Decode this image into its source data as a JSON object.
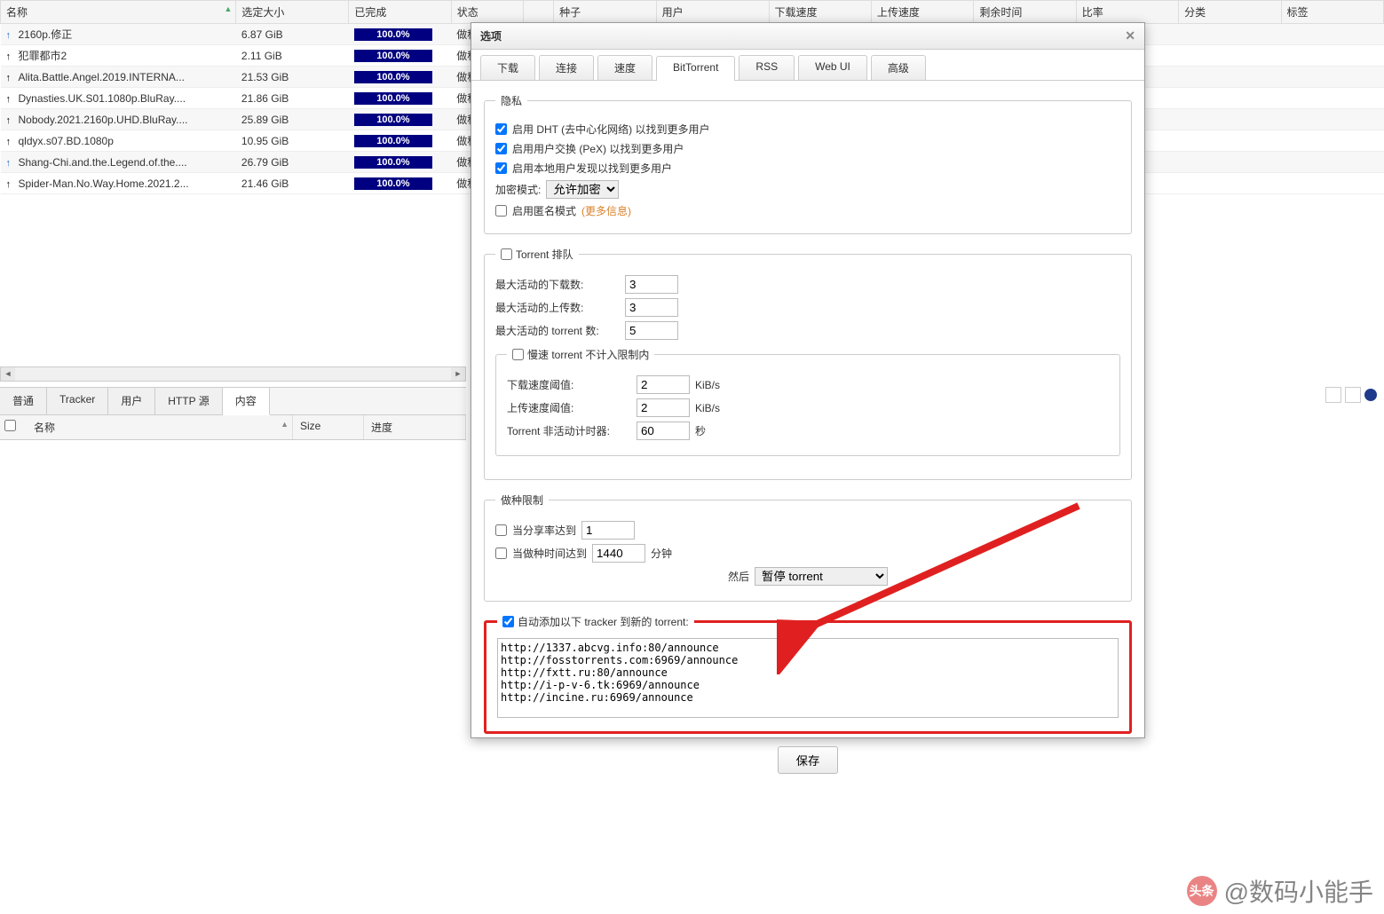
{
  "main": {
    "columns": [
      "名称",
      "选定大小",
      "已完成",
      "状态",
      "",
      "种子",
      "用户",
      "下载速度",
      "上传速度",
      "剩余时间",
      "比率",
      "分类",
      "标签"
    ],
    "sort_col": 0,
    "rows": [
      {
        "icon": "blue",
        "name": "2160p.修正",
        "size": "6.87 GiB",
        "done": "100.0%",
        "status": "做种"
      },
      {
        "icon": "black",
        "name": "犯罪都市2",
        "size": "2.11 GiB",
        "done": "100.0%",
        "status": "做种"
      },
      {
        "icon": "black",
        "name": "Alita.Battle.Angel.2019.INTERNA...",
        "size": "21.53 GiB",
        "done": "100.0%",
        "status": "做种"
      },
      {
        "icon": "black",
        "name": "Dynasties.UK.S01.1080p.BluRay....",
        "size": "21.86 GiB",
        "done": "100.0%",
        "status": "做种"
      },
      {
        "icon": "black",
        "name": "Nobody.2021.2160p.UHD.BluRay....",
        "size": "25.89 GiB",
        "done": "100.0%",
        "status": "做种"
      },
      {
        "icon": "black",
        "name": "qldyx.s07.BD.1080p",
        "size": "10.95 GiB",
        "done": "100.0%",
        "status": "做种"
      },
      {
        "icon": "blue",
        "name": "Shang-Chi.and.the.Legend.of.the....",
        "size": "26.79 GiB",
        "done": "100.0%",
        "status": "做种"
      },
      {
        "icon": "black",
        "name": "Spider-Man.No.Way.Home.2021.2...",
        "size": "21.46 GiB",
        "done": "100.0%",
        "status": "做种"
      }
    ]
  },
  "bottom_tabs": [
    "普通",
    "Tracker",
    "用户",
    "HTTP 源",
    "内容"
  ],
  "bottom_tab_active": 4,
  "content_cols": {
    "name": "名称",
    "size": "Size",
    "progress": "进度"
  },
  "dialog": {
    "title": "选项",
    "tabs": [
      "下载",
      "连接",
      "速度",
      "BitTorrent",
      "RSS",
      "Web UI",
      "高级"
    ],
    "tab_active": 3,
    "privacy": {
      "legend": "隐私",
      "dht": "启用 DHT (去中心化网络) 以找到更多用户",
      "pex": "启用用户交换 (PeX) 以找到更多用户",
      "lsd": "启用本地用户发现以找到更多用户",
      "enc_label": "加密模式:",
      "enc_value": "允许加密",
      "anon": "启用匿名模式",
      "anon_more": "(更多信息)"
    },
    "queue": {
      "legend": "Torrent 排队",
      "max_dl": "最大活动的下载数:",
      "max_dl_v": "3",
      "max_ul": "最大活动的上传数:",
      "max_ul_v": "3",
      "max_t": "最大活动的 torrent 数:",
      "max_t_v": "5",
      "slow": {
        "legend": "慢速 torrent 不计入限制内",
        "dl_th": "下载速度阈值:",
        "dl_th_v": "2",
        "ul_th": "上传速度阈值:",
        "ul_th_v": "2",
        "unit": "KiB/s",
        "inact": "Torrent 非活动计时器:",
        "inact_v": "60",
        "sec": "秒"
      }
    },
    "seedlimit": {
      "legend": "做种限制",
      "ratio": "当分享率达到",
      "ratio_v": "1",
      "time": "当做种时间达到",
      "time_v": "1440",
      "min": "分钟",
      "then": "然后",
      "action": "暂停 torrent"
    },
    "trackers": {
      "legend": "自动添加以下 tracker 到新的 torrent:",
      "text": "http://1337.abcvg.info:80/announce\nhttp://fosstorrents.com:6969/announce\nhttp://fxtt.ru:80/announce\nhttp://i-p-v-6.tk:6969/announce\nhttp://incine.ru:6969/announce"
    },
    "save": "保存"
  },
  "watermark": {
    "logo": "头条",
    "text": "@数码小能手"
  }
}
